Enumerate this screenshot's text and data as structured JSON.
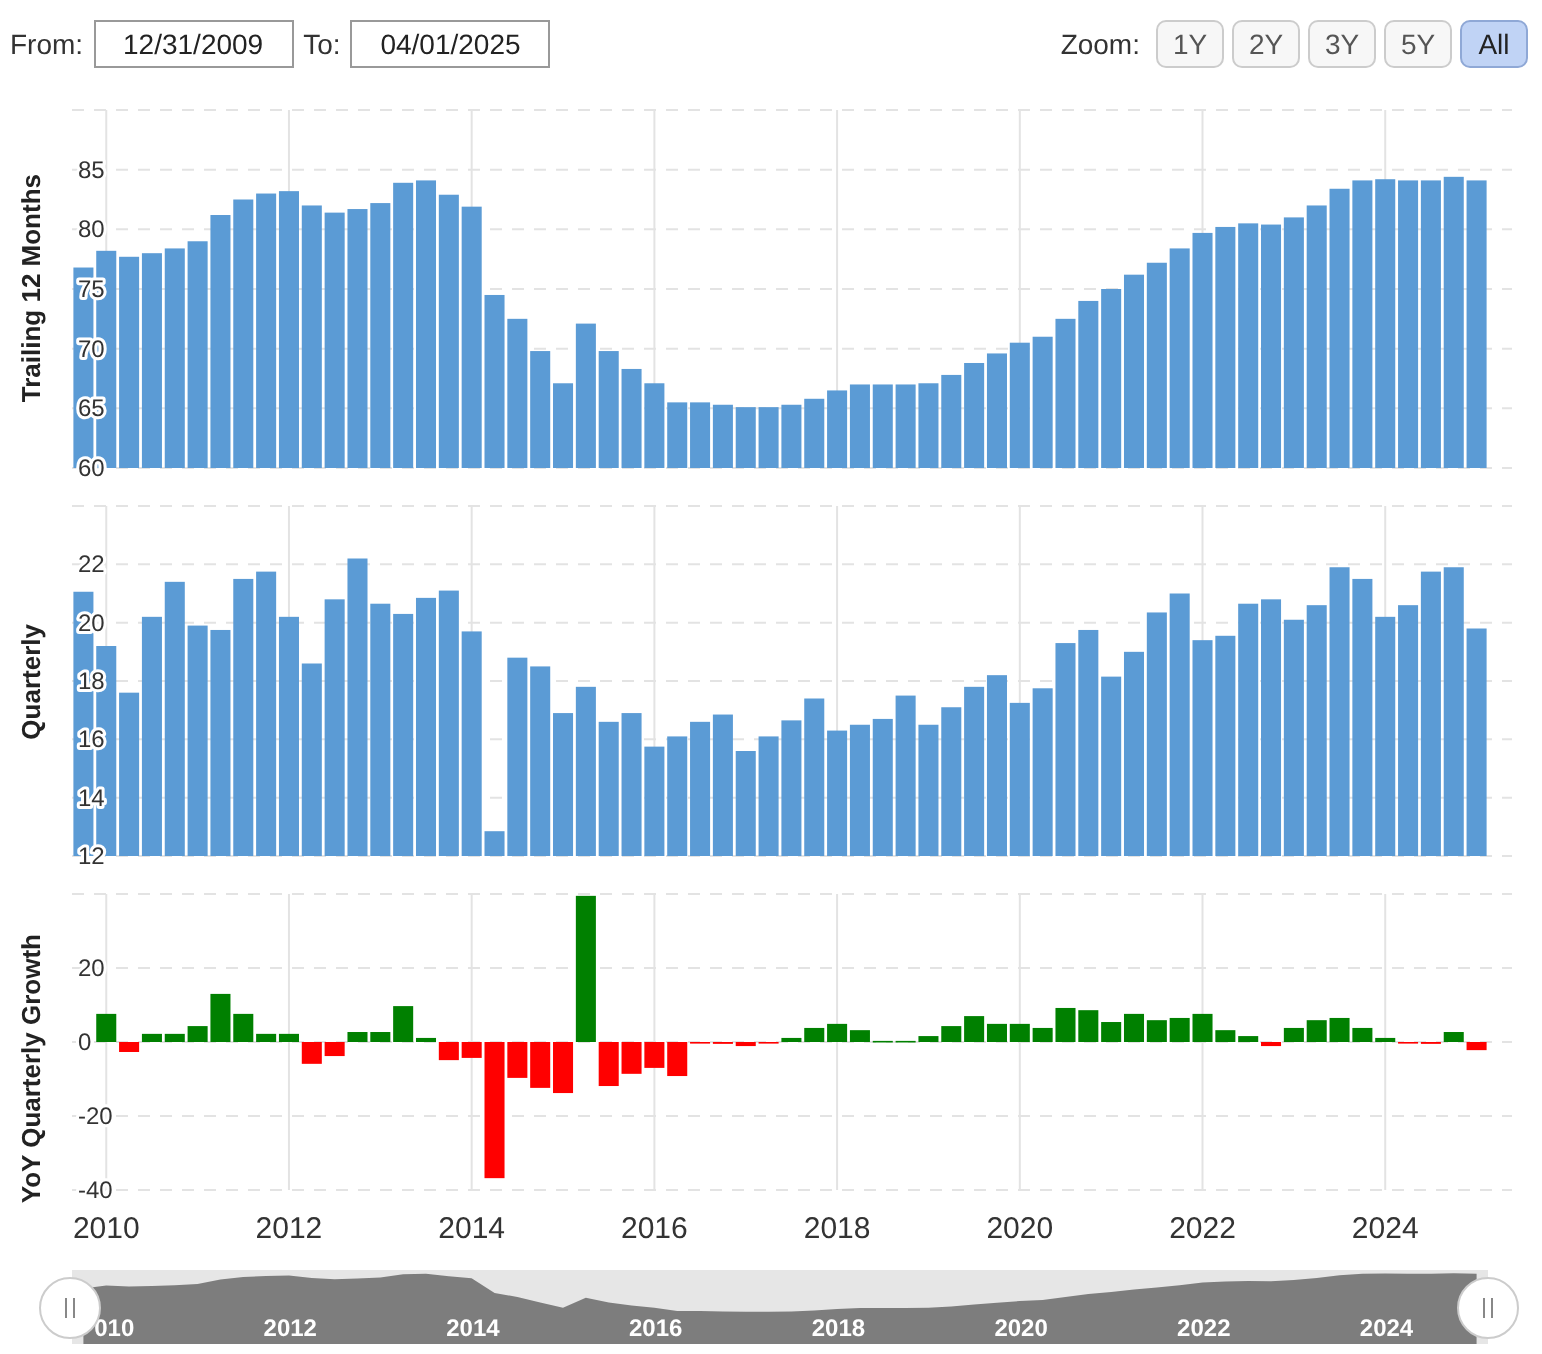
{
  "date_range": {
    "from_label": "From:",
    "from": "12/31/2009",
    "to_label": "To:",
    "to": "04/01/2025"
  },
  "zoom": {
    "label": "Zoom:",
    "buttons": [
      {
        "label": "1Y",
        "selected": false
      },
      {
        "label": "2Y",
        "selected": false
      },
      {
        "label": "3Y",
        "selected": false
      },
      {
        "label": "5Y",
        "selected": false
      },
      {
        "label": "All",
        "selected": true
      }
    ]
  },
  "charts": [
    {
      "chart_data": {
        "type": "bar",
        "ylabel": "Trailing 12 Months",
        "ylim": [
          60,
          90
        ],
        "yticks": [
          60,
          65,
          70,
          75,
          80,
          85
        ],
        "grid": true,
        "series": [
          {
            "color": "#5b9bd5",
            "values": [
              76.8,
              78.2,
              77.7,
              78.0,
              78.4,
              79.0,
              81.2,
              82.5,
              83.0,
              83.2,
              82.0,
              81.4,
              81.7,
              82.2,
              83.9,
              84.1,
              82.9,
              81.9,
              74.5,
              72.5,
              69.8,
              67.1,
              72.1,
              69.8,
              68.3,
              67.1,
              65.5,
              65.5,
              65.3,
              65.1,
              65.1,
              65.3,
              65.8,
              66.5,
              67.0,
              67.0,
              67.0,
              67.1,
              67.8,
              68.8,
              69.6,
              70.5,
              71.0,
              72.5,
              74.0,
              75.0,
              76.2,
              77.2,
              78.4,
              79.7,
              80.2,
              80.5,
              80.4,
              81.0,
              82.0,
              83.4,
              84.1,
              84.2,
              84.1,
              84.1,
              84.4,
              84.1
            ]
          }
        ]
      }
    },
    {
      "chart_data": {
        "type": "bar",
        "ylabel": "Quarterly",
        "ylim": [
          12,
          24
        ],
        "yticks": [
          12,
          14,
          16,
          18,
          20,
          22
        ],
        "grid": true,
        "series": [
          {
            "color": "#5b9bd5",
            "values": [
              21.06,
              19.2,
              17.6,
              20.2,
              21.4,
              19.9,
              19.75,
              21.5,
              21.75,
              20.2,
              18.6,
              20.8,
              22.2,
              20.65,
              20.3,
              20.85,
              21.1,
              19.7,
              12.85,
              18.8,
              18.5,
              16.9,
              17.8,
              16.6,
              16.9,
              15.75,
              16.1,
              16.6,
              16.85,
              15.6,
              16.1,
              16.65,
              17.4,
              16.3,
              16.5,
              16.7,
              17.5,
              16.5,
              17.1,
              17.8,
              18.2,
              17.25,
              17.75,
              19.3,
              19.75,
              18.15,
              19.0,
              20.35,
              21.0,
              19.4,
              19.55,
              20.65,
              20.8,
              20.1,
              20.6,
              21.9,
              21.5,
              20.2,
              20.6,
              21.75,
              21.9,
              19.8
            ]
          }
        ]
      }
    },
    {
      "chart_data": {
        "type": "bar",
        "ylabel": "YoY Quarterly Growth",
        "xlim": [
          2009.625,
          2025.125
        ],
        "ylim": [
          -40,
          40
        ],
        "yticks": [
          -40,
          -20,
          0,
          20
        ],
        "xticks": [
          2010,
          2012,
          2014,
          2016,
          2018,
          2020,
          2022,
          2024
        ],
        "grid": true,
        "stacked": true,
        "x": [
          2010,
          2010.25,
          2010.5,
          2010.75,
          2011,
          2011.25,
          2011.5,
          2011.75,
          2012,
          2012.25,
          2012.5,
          2012.75,
          2013,
          2013.25,
          2013.5,
          2013.75,
          2014,
          2014.25,
          2014.5,
          2014.75,
          2015,
          2015.25,
          2015.5,
          2015.75,
          2016,
          2016.25,
          2016.5,
          2016.75,
          2017,
          2017.25,
          2017.5,
          2017.75,
          2018,
          2018.25,
          2018.5,
          2018.75,
          2019,
          2019.25,
          2019.5,
          2019.75,
          2020,
          2020.25,
          2020.5,
          2020.75,
          2021,
          2021.25,
          2021.5,
          2021.75,
          2022,
          2022.25,
          2022.5,
          2022.75,
          2023,
          2023.25,
          2023.5,
          2023.75,
          2024,
          2024.25,
          2024.5,
          2024.75,
          2025
        ],
        "series": [
          {
            "color": "#008000",
            "values": [
              7.6,
              null,
              2.2,
              2.2,
              4.3,
              13.0,
              7.6,
              2.2,
              2.2,
              null,
              null,
              2.7,
              2.7,
              9.7,
              1.1,
              null,
              null,
              null,
              null,
              null,
              null,
              39.5,
              null,
              null,
              null,
              null,
              null,
              null,
              null,
              null,
              1.1,
              3.8,
              4.9,
              3.2,
              0.3,
              0.3,
              1.6,
              4.3,
              7.0,
              4.9,
              4.9,
              3.8,
              9.2,
              8.6,
              5.4,
              7.6,
              5.9,
              6.5,
              7.6,
              3.2,
              1.6,
              null,
              3.8,
              5.9,
              6.5,
              3.8,
              1.1,
              null,
              null,
              2.7,
              null
            ]
          },
          {
            "color": "#ff0000",
            "values": [
              null,
              -2.7,
              null,
              null,
              null,
              null,
              null,
              null,
              null,
              -5.9,
              -3.8,
              null,
              null,
              null,
              null,
              -4.9,
              -4.3,
              -36.8,
              -9.7,
              -12.4,
              -13.8,
              null,
              -11.9,
              -8.6,
              -7.0,
              -9.2,
              -0.3,
              -0.5,
              -1.1,
              -0.3,
              null,
              null,
              null,
              null,
              null,
              null,
              null,
              null,
              null,
              null,
              null,
              null,
              null,
              null,
              null,
              null,
              null,
              null,
              null,
              null,
              null,
              -1.1,
              null,
              null,
              null,
              null,
              null,
              -0.3,
              -0.5,
              null,
              -2.2
            ]
          }
        ]
      }
    }
  ],
  "navigator": {
    "labels": [
      "010",
      "2012",
      "2014",
      "2016",
      "2018",
      "2020",
      "2022",
      "2024"
    ]
  }
}
